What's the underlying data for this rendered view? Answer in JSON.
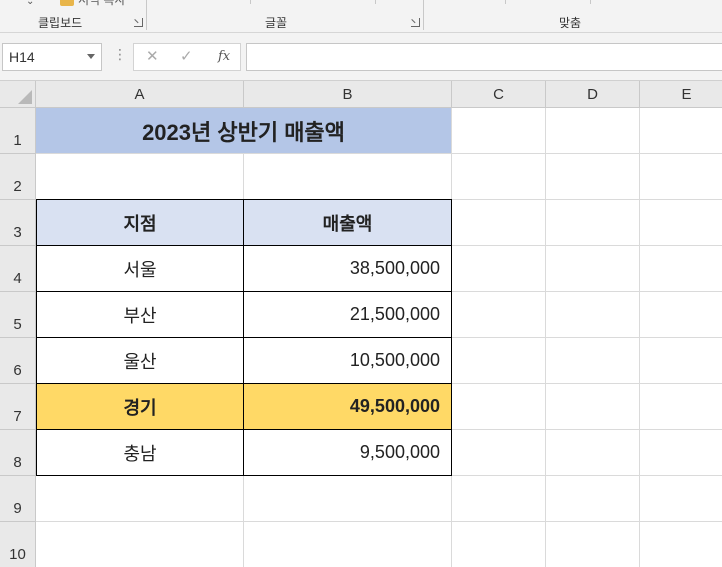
{
  "ribbon": {
    "groups": [
      {
        "label": "클립보드"
      },
      {
        "label": "글꼴"
      },
      {
        "label": "맞춤"
      }
    ],
    "cutoff_text": "서식 복사"
  },
  "formula_bar": {
    "name_box": "H14",
    "cancel_glyph": "✕",
    "enter_glyph": "✓",
    "fx_label": "fx",
    "formula": ""
  },
  "sheet": {
    "columns": [
      "A",
      "B",
      "C",
      "D",
      "E"
    ],
    "rows": [
      "1",
      "2",
      "3",
      "4",
      "5",
      "6",
      "7",
      "8",
      "9",
      "10"
    ],
    "title": "2023년 상반기 매출액",
    "table": {
      "headers": [
        "지점",
        "매출액"
      ],
      "data": [
        {
          "branch": "서울",
          "sales": "38,500,000"
        },
        {
          "branch": "부산",
          "sales": "21,500,000"
        },
        {
          "branch": "울산",
          "sales": "10,500,000"
        },
        {
          "branch": "경기",
          "sales": "49,500,000"
        },
        {
          "branch": "충남",
          "sales": "9,500,000"
        }
      ]
    }
  },
  "colors": {
    "title_fill": "#b4c6e7",
    "header_fill": "#d9e1f2",
    "highlight_fill": "#ffd966",
    "border": "#000000"
  }
}
